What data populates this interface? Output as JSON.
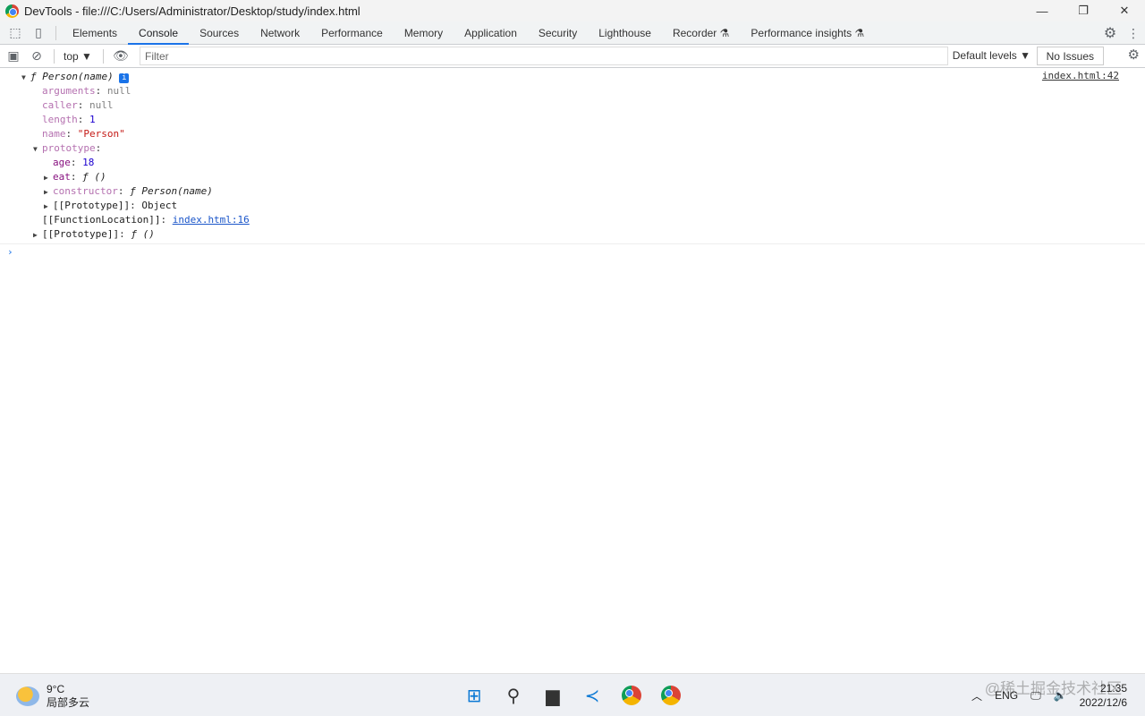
{
  "window": {
    "title": "DevTools - file:///C:/Users/Administrator/Desktop/study/index.html"
  },
  "tabs": [
    "Elements",
    "Console",
    "Sources",
    "Network",
    "Performance",
    "Memory",
    "Application",
    "Security",
    "Lighthouse",
    "Recorder ⚗",
    "Performance insights ⚗"
  ],
  "active_tab": "Console",
  "toolbar": {
    "context": "top ▼",
    "filter_placeholder": "Filter",
    "levels": "Default levels ▼",
    "issues": "No Issues"
  },
  "console": {
    "source": "index.html:42",
    "header": "Person(name)",
    "f": "ƒ",
    "rows": {
      "arguments_k": "arguments",
      "arguments_v": "null",
      "caller_k": "caller",
      "caller_v": "null",
      "length_k": "length",
      "length_v": "1",
      "name_k": "name",
      "name_v": "\"Person\"",
      "prototype_k": "prototype",
      "age_k": "age",
      "age_v": "18",
      "eat_k": "eat",
      "eat_v": "ƒ ()",
      "constructor_k": "constructor",
      "constructor_v": "ƒ Person(name)",
      "proto_inner_k": "[[Prototype]]",
      "proto_inner_v": "Object",
      "fl_k": "[[FunctionLocation]]",
      "fl_v": "index.html:16",
      "proto_outer_k": "[[Prototype]]",
      "proto_outer_v": "ƒ ()"
    }
  },
  "taskbar": {
    "temp": "9°C",
    "weather": "局部多云",
    "lang": "ENG",
    "time": "21:35",
    "date": "2022/12/6",
    "watermark": "@稀土掘金技术社区"
  }
}
